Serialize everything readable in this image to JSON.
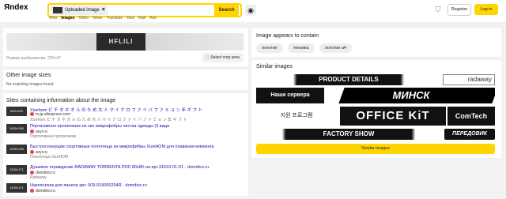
{
  "header": {
    "logo": "Яndex",
    "search_chip": "Uploaded image",
    "search_button": "Search",
    "tabs": [
      "Web",
      "Images",
      "Video",
      "News",
      "Translate",
      "Disk",
      "Mail",
      "Ads"
    ],
    "register": "Register",
    "login": "Log in"
  },
  "main": {
    "image_size_label": "Размер изображения: 220×47",
    "crop_button": "Select crop area",
    "hf_logo": "HFLILI",
    "other_sizes_title": "Other image sizes",
    "other_sizes_empty": "No matching images found",
    "sites_title": "Sites containing information about the image",
    "sites": [
      {
        "thumb": "640×100",
        "title": "Xizehom ピ チ タ ネ オ ル の た め 大 人 マ イ ク ロ フ ァ イ バ フ ァ ミ ョ ン 年 ギ フ ト",
        "domain": "m.jp.aliexpress.com",
        "desc": "Xizehom ピ チ タ ネ オ ル の た め 大 人 マ イ ク ロ フ ァ イ バ フ ァ ミ ョ ン 年 ギ フ ト"
      },
      {
        "thumb": "1000×150",
        "title": "Портативное пропитание из эко микрофибры чистка одежды (3 вида",
        "domain": "avyi.ru",
        "desc": "Портативное пропитание"
      },
      {
        "thumb": "1000×150",
        "title": "Быстросохнущие спортивные полотенца из микрофибры XizeHOM для плавания кемпинга",
        "domain": "avyi.ru",
        "desc": "Полотенца XizeHOM"
      },
      {
        "thumb": "1100×171",
        "title": "Душевое ограждение RADAWAY TORRENTA PDD 80x80 см арт.31610-01-01 - domdivo.ru",
        "domain": "domdivo.ru",
        "desc": "Radaway"
      },
      {
        "thumb": "1100×171",
        "title": "Накопничик для панели арт. 003-019000204R - domdivo.ru",
        "domain": "domdivo.ru",
        "desc": ""
      }
    ]
  },
  "right": {
    "appears_title": "Image appears to contain",
    "tags": [
      "логотип",
      "техника",
      "логотип а4"
    ],
    "similar_title": "Similar images",
    "similar": [
      "PRODUCT DETAILS",
      "radaway",
      "Наши сервера",
      "МИНСК",
      "지원 프로그램",
      "OFFICE KiT",
      "ComTech",
      "FACTORY SHOW",
      "ПЕРЕДОВИК"
    ],
    "similar_button": "Similar images"
  },
  "colors": {
    "accent": "#ffd400",
    "link": "#1a0dab"
  }
}
